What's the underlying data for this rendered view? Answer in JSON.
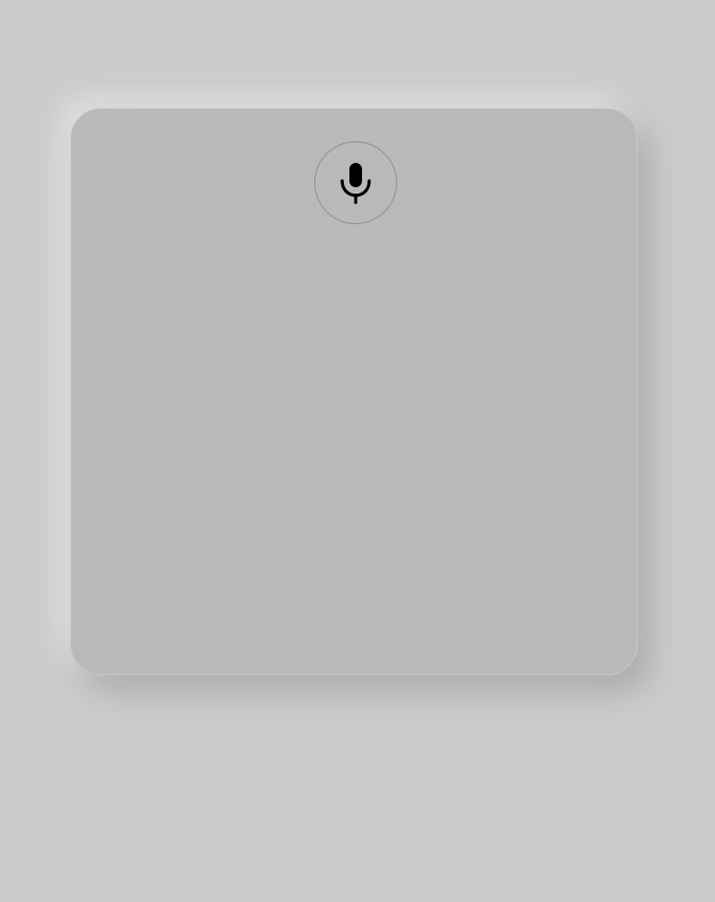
{
  "colors": {
    "background": "#cbcbcb",
    "panel": "#b9b9b9",
    "icon": "#000000"
  },
  "mic_button": {
    "icon": "microphone-icon"
  }
}
